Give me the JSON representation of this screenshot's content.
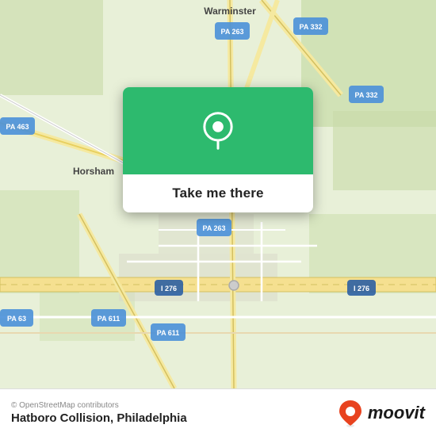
{
  "map": {
    "attribution": "© OpenStreetMap contributors",
    "background_color": "#e8f0d8"
  },
  "popup": {
    "button_label": "Take me there",
    "pin_color": "#ffffff"
  },
  "bottom_bar": {
    "location_name": "Hatboro Collision, Philadelphia",
    "moovit_label": "moovit"
  },
  "labels": {
    "warminster": "Warminster",
    "horsham": "Horsham",
    "pa_263_top": "PA 263",
    "pa_332_top": "PA 332",
    "pa_332_mid": "PA 332",
    "pa_463": "PA 463",
    "pa_263_mid": "PA 263",
    "pa_611": "PA 611",
    "pa_611b": "PA 611",
    "pa_63": "PA 63",
    "i_276_left": "I 276",
    "i_276_right": "I 276"
  }
}
